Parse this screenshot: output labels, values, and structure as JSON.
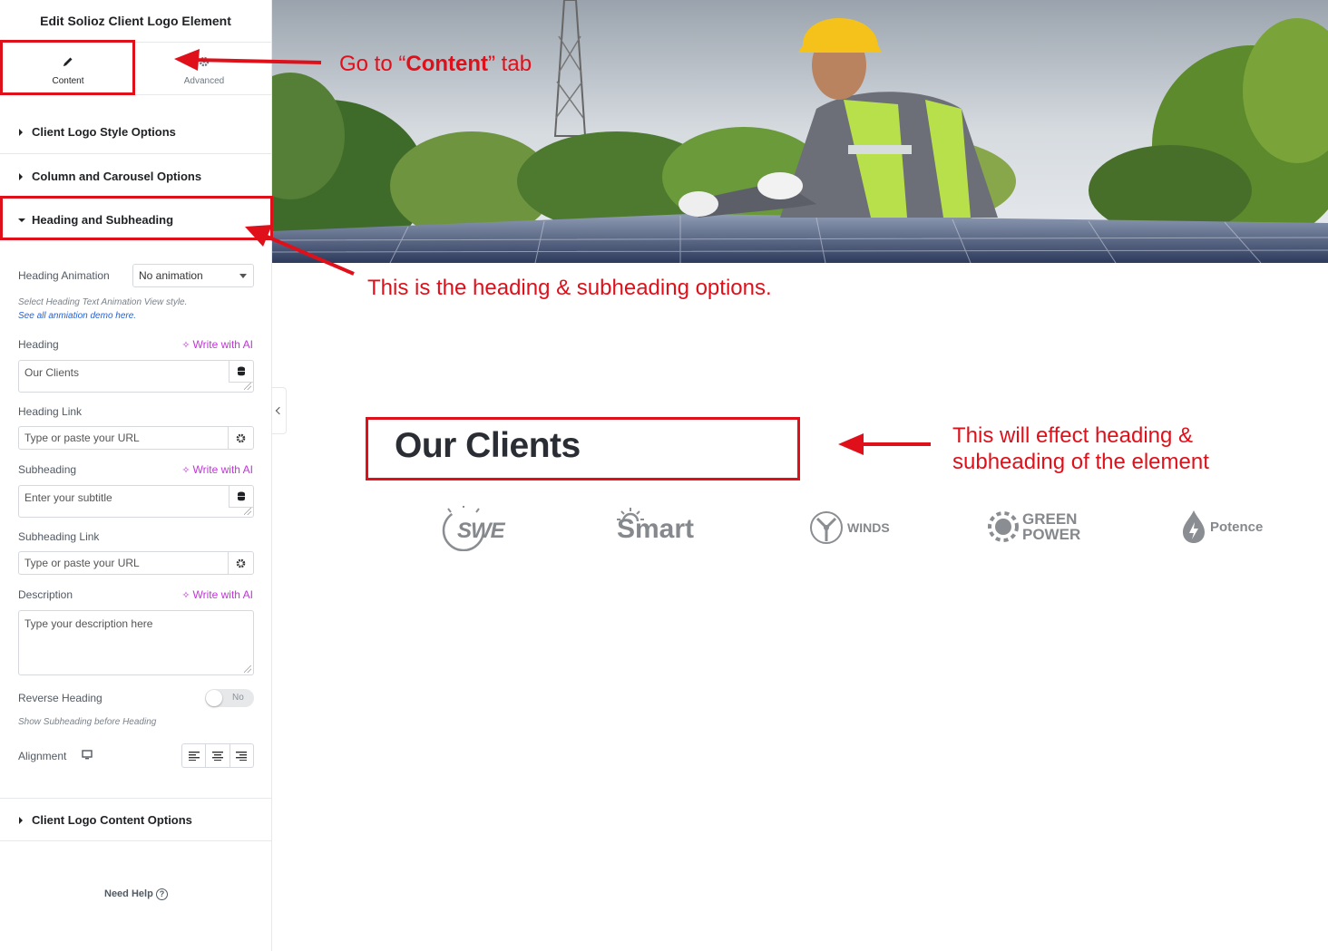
{
  "panel": {
    "title": "Edit Solioz Client Logo Element",
    "tabs": [
      {
        "label": "Content",
        "icon": "pencil-icon"
      },
      {
        "label": "Advanced",
        "icon": "gear-icon"
      }
    ]
  },
  "sections": {
    "style_options": "Client Logo Style Options",
    "carousel_options": "Column and Carousel Options",
    "heading_subheading": "Heading and Subheading",
    "content_options": "Client Logo Content Options"
  },
  "controls": {
    "heading_animation": {
      "label": "Heading Animation",
      "value": "No animation"
    },
    "animation_hint": "Select Heading Text Animation View style.",
    "animation_demo_link": "See all anmiation demo here.",
    "heading": {
      "label": "Heading",
      "value": "Our Clients"
    },
    "heading_link": {
      "label": "Heading Link",
      "placeholder": "Type or paste your URL"
    },
    "subheading": {
      "label": "Subheading",
      "placeholder": "Enter your subtitle"
    },
    "subheading_link": {
      "label": "Subheading Link",
      "placeholder": "Type or paste your URL"
    },
    "description": {
      "label": "Description",
      "placeholder": "Type your description here"
    },
    "reverse_heading": {
      "label": "Reverse Heading",
      "toggle": "No",
      "hint": "Show Subheading before Heading"
    },
    "alignment": {
      "label": "Alignment"
    },
    "write_with_ai": "Write with AI"
  },
  "help": {
    "label": "Need Help"
  },
  "canvas": {
    "heading": "Our Clients",
    "logos": [
      "SWE",
      "Smart",
      "WINDS",
      "GREEN POWER",
      "Potence"
    ]
  },
  "annotations": {
    "content_tab_pre": "Go  to “",
    "content_tab_bold": "Content",
    "content_tab_post": "” tab",
    "options_note": "This is the heading & subheading options.",
    "effect_note_line1": "This will effect heading &",
    "effect_note_line2": "subheading of the element"
  },
  "colors": {
    "annotation_red": "#e0101a",
    "ai_purple": "#c036d6",
    "link_blue": "#2463d6"
  }
}
